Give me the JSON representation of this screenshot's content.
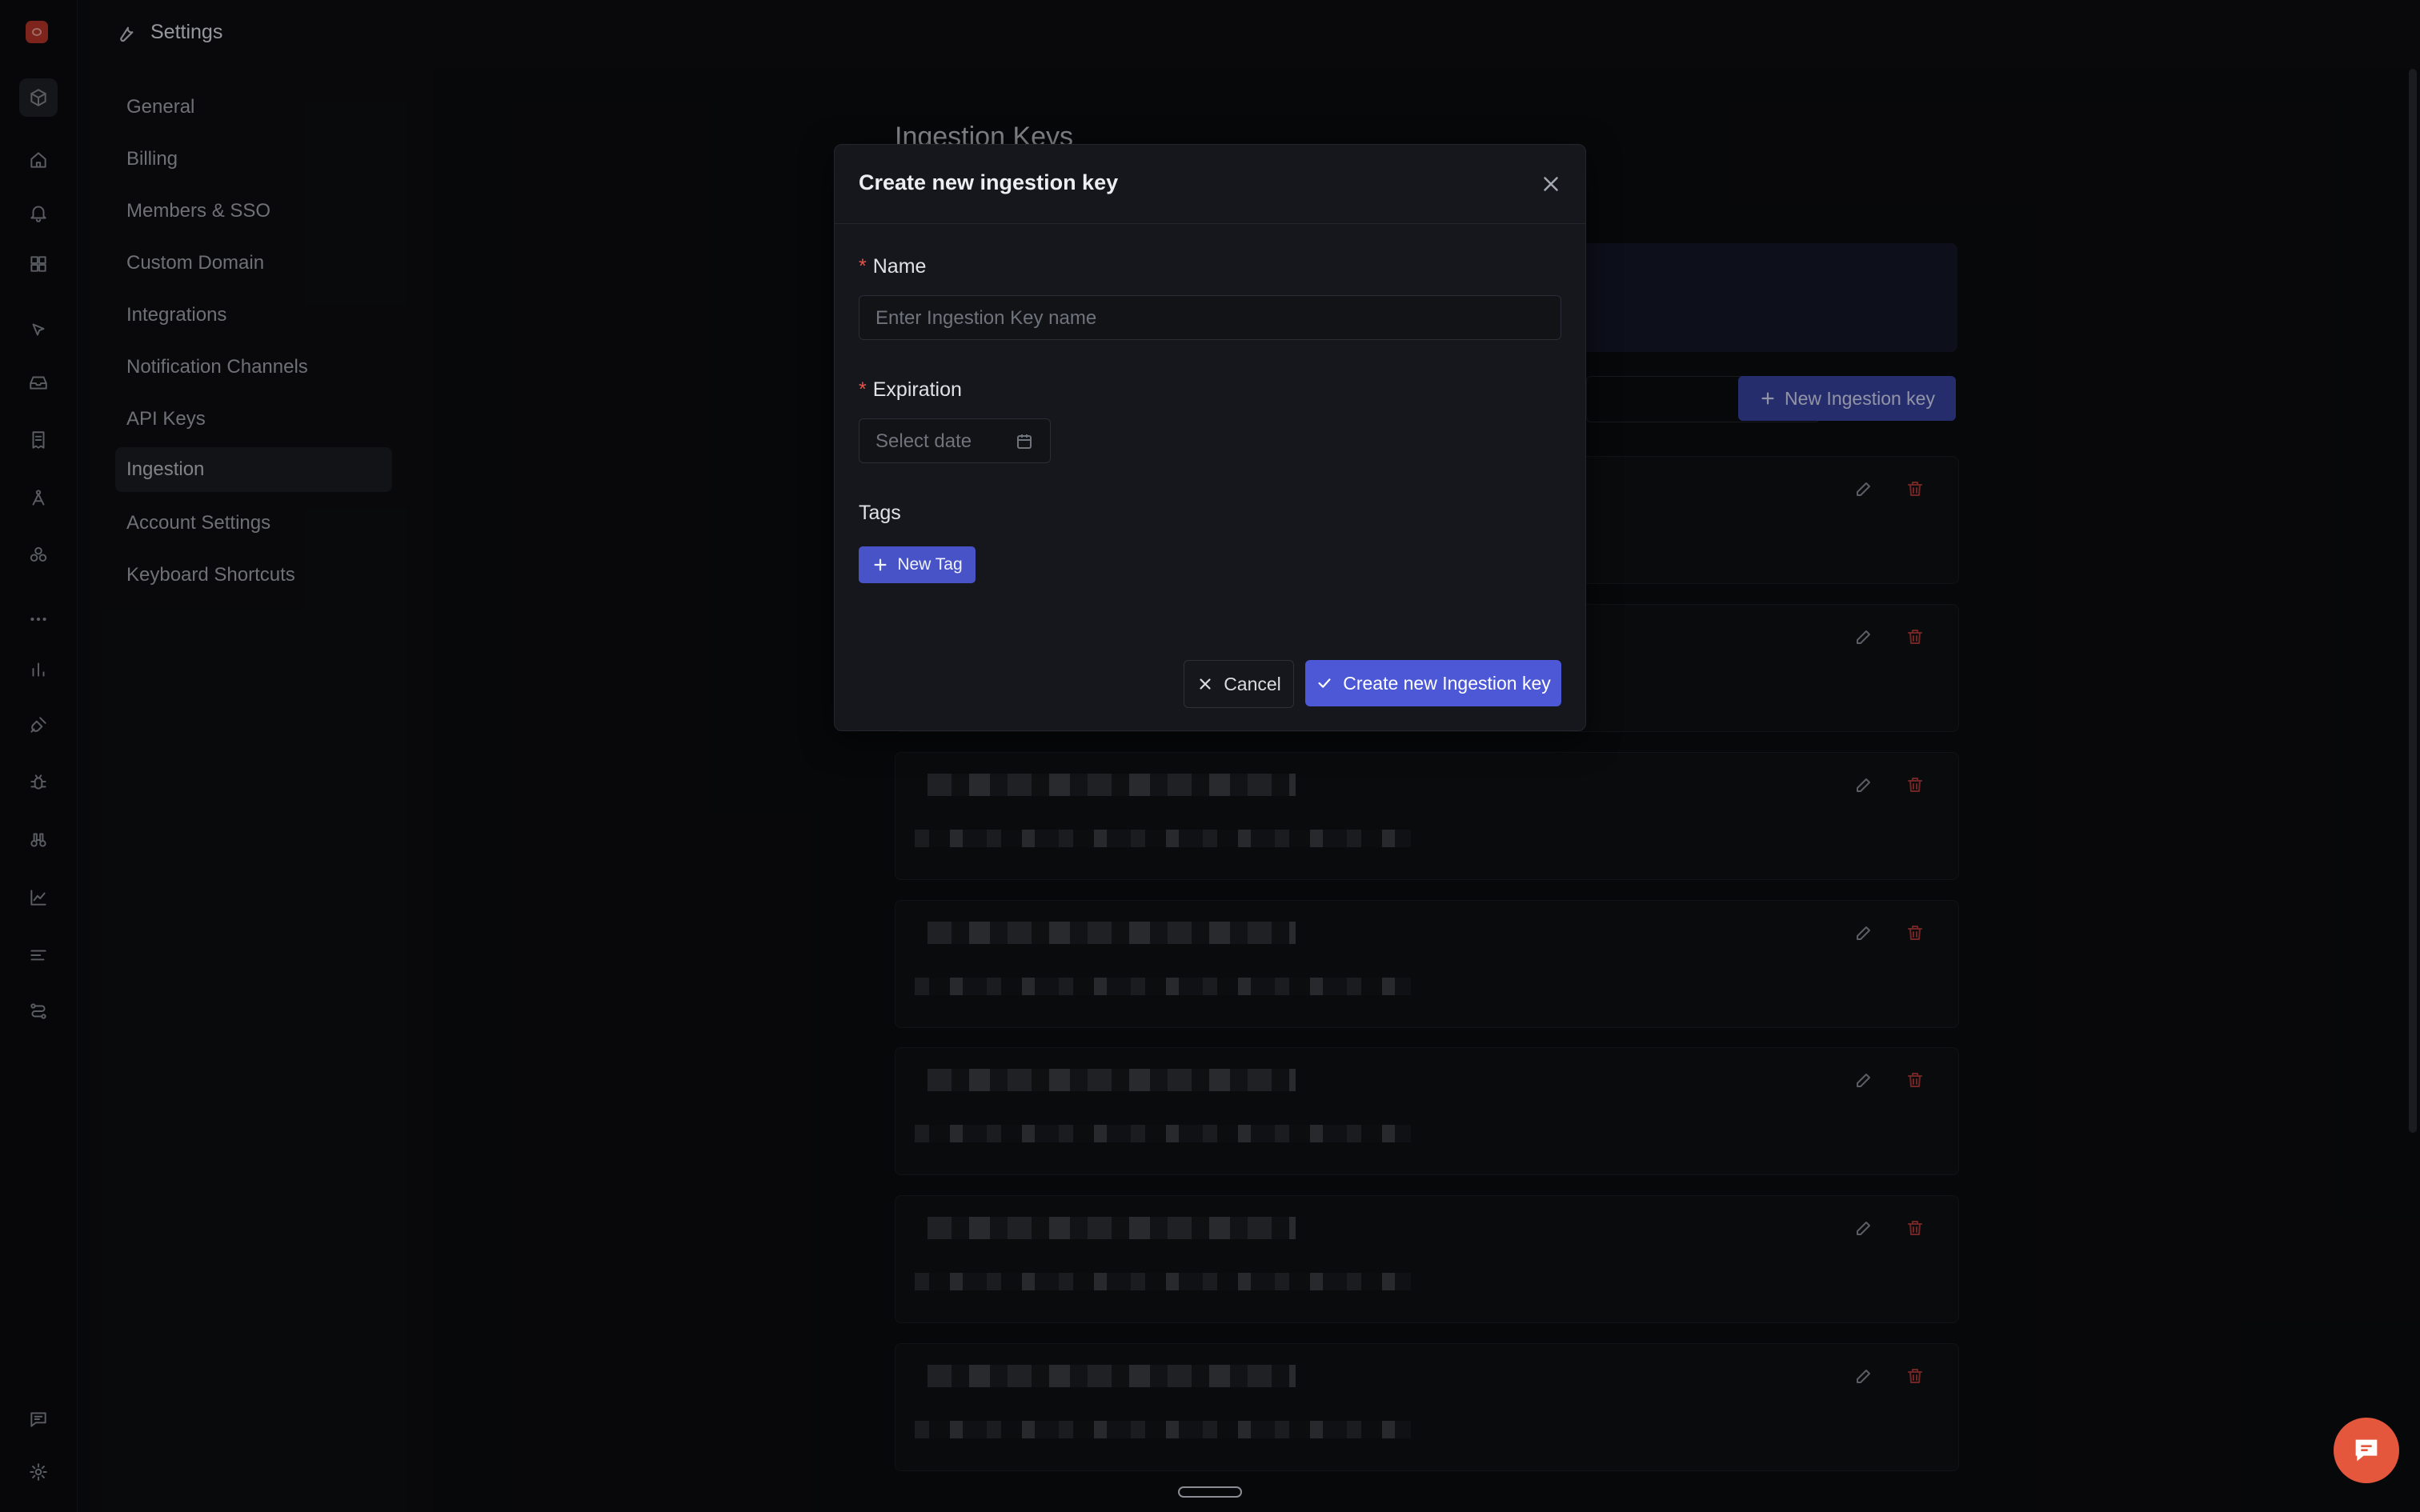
{
  "topbar": {
    "title": "Settings"
  },
  "sidenav": {
    "items": [
      {
        "label": "General"
      },
      {
        "label": "Billing"
      },
      {
        "label": "Members & SSO"
      },
      {
        "label": "Custom Domain"
      },
      {
        "label": "Integrations"
      },
      {
        "label": "Notification Channels"
      },
      {
        "label": "API Keys"
      },
      {
        "label": "Ingestion"
      },
      {
        "label": "Account Settings"
      },
      {
        "label": "Keyboard Shortcuts"
      }
    ],
    "active": "Ingestion"
  },
  "main": {
    "heading": "Ingestion Keys",
    "new_key_button": "New Ingestion key"
  },
  "modal": {
    "title": "Create new ingestion key",
    "name_label": "Name",
    "name_placeholder": "Enter Ingestion Key name",
    "expiration_label": "Expiration",
    "date_placeholder": "Select date",
    "tags_label": "Tags",
    "new_tag_button": "New Tag",
    "cancel_button": "Cancel",
    "create_button": "Create new Ingestion key"
  },
  "colors": {
    "primary": "#4c58d6",
    "danger": "#b0393a",
    "required": "#e5534b",
    "chat": "#e4573d"
  },
  "icons": [
    "logo-icon",
    "cube-icon",
    "home-icon",
    "bell-icon",
    "grid-icon",
    "cursor-icon",
    "inbox-icon",
    "receipt-icon",
    "graph-icon",
    "hexagons-icon",
    "more-icon",
    "bar-chart-icon",
    "plug-icon",
    "bug-icon",
    "binoculars-icon",
    "line-chart-icon",
    "list-icon",
    "route-icon",
    "message-icon",
    "gear-icon",
    "wrench-icon",
    "calendar-icon",
    "plus-icon",
    "check-icon",
    "close-icon",
    "edit-icon",
    "trash-icon",
    "chat-icon"
  ]
}
